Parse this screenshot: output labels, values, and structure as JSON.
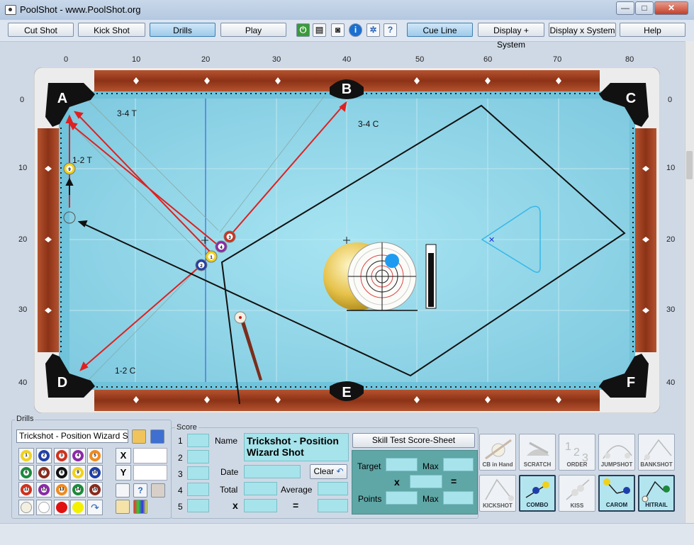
{
  "window": {
    "title": "PoolShot - www.PoolShot.org",
    "minimize": "—",
    "maximize": "□",
    "close": "✕"
  },
  "toolbar": {
    "buttons": [
      "Cut Shot",
      "Kick Shot",
      "Drills",
      "Play",
      "Cue Line",
      "Display + System",
      "Display x System",
      "Help"
    ],
    "active": [
      "Drills",
      "Cue Line"
    ],
    "icons": [
      "power-icon",
      "printer-icon",
      "camera-icon",
      "info-icon",
      "gear-icon",
      "help-icon"
    ]
  },
  "rulers": {
    "top": [
      "0",
      "10",
      "20",
      "30",
      "40",
      "50",
      "60",
      "70",
      "80"
    ],
    "side": [
      "0",
      "10",
      "20",
      "30",
      "40"
    ]
  },
  "table": {
    "pockets": [
      "A",
      "B",
      "C",
      "D",
      "E",
      "F"
    ],
    "labels": [
      "3-4 T",
      "3-4 C",
      "1-2 T",
      "1-2 C"
    ],
    "balls": [
      "1",
      "2",
      "3",
      "4",
      "9"
    ],
    "colors": {
      "cloth": "#8fd3e6",
      "rail": "#9a3b22",
      "cushion": "#7ccde2",
      "frame": "#eeeeee",
      "aim_line": "#e02020"
    }
  },
  "drills": {
    "panel_label": "Drills",
    "name": "Trickshot - Position Wizard Shot",
    "balls": [
      "1",
      "2",
      "3",
      "4",
      "5",
      "6",
      "7",
      "8",
      "9",
      "10",
      "11",
      "12",
      "13",
      "14",
      "15"
    ],
    "x_label": "X",
    "y_label": "Y"
  },
  "score": {
    "panel_label": "Score",
    "rows": [
      "1",
      "2",
      "3",
      "4",
      "5"
    ],
    "name_label": "Name",
    "name_value": "Trickshot - Position Wizard Shot",
    "date_label": "Date",
    "clear_label": "Clear",
    "total_label": "Total",
    "average_label": "Average",
    "x_label": "x",
    "equals_label": "="
  },
  "skill": {
    "button": "Skill Test Score-Sheet",
    "target": "Target",
    "max": "Max",
    "points": "Points",
    "times": "x",
    "equals": "="
  },
  "shot_types": [
    "CB in Hand",
    "SCRATCH",
    "ORDER",
    "JUMPSHOT",
    "BANKSHOT",
    "KICKSHOT",
    "COMBO",
    "KISS",
    "CAROM",
    "HITRAIL"
  ],
  "selected_shots": [
    "COMBO",
    "CAROM",
    "HITRAIL"
  ]
}
